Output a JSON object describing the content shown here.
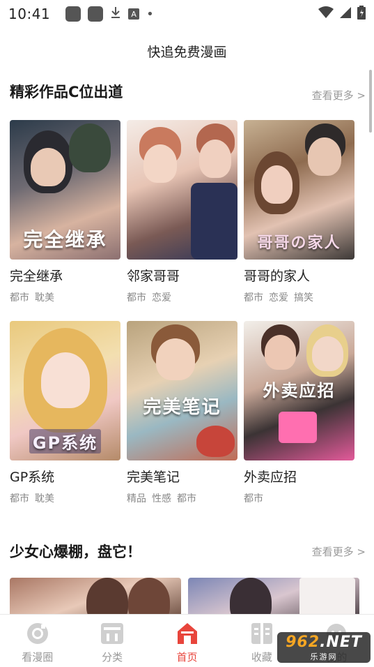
{
  "status_bar": {
    "time": "10:41",
    "left_icons": [
      "app-icon",
      "app-icon",
      "download-icon",
      "a-icon",
      "dot-icon"
    ],
    "a_glyph": "A",
    "right_icons": [
      "wifi-icon",
      "signal-icon",
      "battery-icon"
    ]
  },
  "app_header": {
    "title": "快追免费漫画"
  },
  "section1": {
    "title": "精彩作品C位出道",
    "more": "查看更多 >",
    "items": [
      {
        "title": "完全继承",
        "tags": [
          "都市",
          "耽美"
        ],
        "cover_text": "完全继承",
        "palette": "c1"
      },
      {
        "title": "邻家哥哥",
        "tags": [
          "都市",
          "恋爱"
        ],
        "cover_text": "",
        "palette": "c2"
      },
      {
        "title": "哥哥的家人",
        "tags": [
          "都市",
          "恋爱",
          "搞笑"
        ],
        "cover_text": "哥哥の家人",
        "palette": "c3"
      },
      {
        "title": "GP系统",
        "tags": [
          "都市",
          "耽美"
        ],
        "cover_text": "GP系统",
        "palette": "c4"
      },
      {
        "title": "完美笔记",
        "tags": [
          "精品",
          "性感",
          "都市"
        ],
        "cover_text": "完美笔记",
        "palette": "c5"
      },
      {
        "title": "外卖应招",
        "tags": [
          "都市"
        ],
        "cover_text": "外卖应招",
        "palette": "c6"
      }
    ]
  },
  "section2": {
    "title": "少女心爆棚，盘它！",
    "more": "查看更多 >"
  },
  "tab_bar": {
    "tabs": [
      {
        "label": "看漫圈",
        "icon": "circle-icon",
        "active": false
      },
      {
        "label": "分类",
        "icon": "category-icon",
        "active": false
      },
      {
        "label": "首页",
        "icon": "home-icon",
        "active": true
      },
      {
        "label": "收藏",
        "icon": "book-icon",
        "active": false
      },
      {
        "label": "我的",
        "icon": "profile-icon",
        "active": false
      }
    ]
  },
  "watermark": {
    "brand_a": "962",
    "brand_b": ".NET",
    "sub": "乐游网"
  },
  "colors": {
    "accent": "#e8453c",
    "muted": "#999999"
  }
}
